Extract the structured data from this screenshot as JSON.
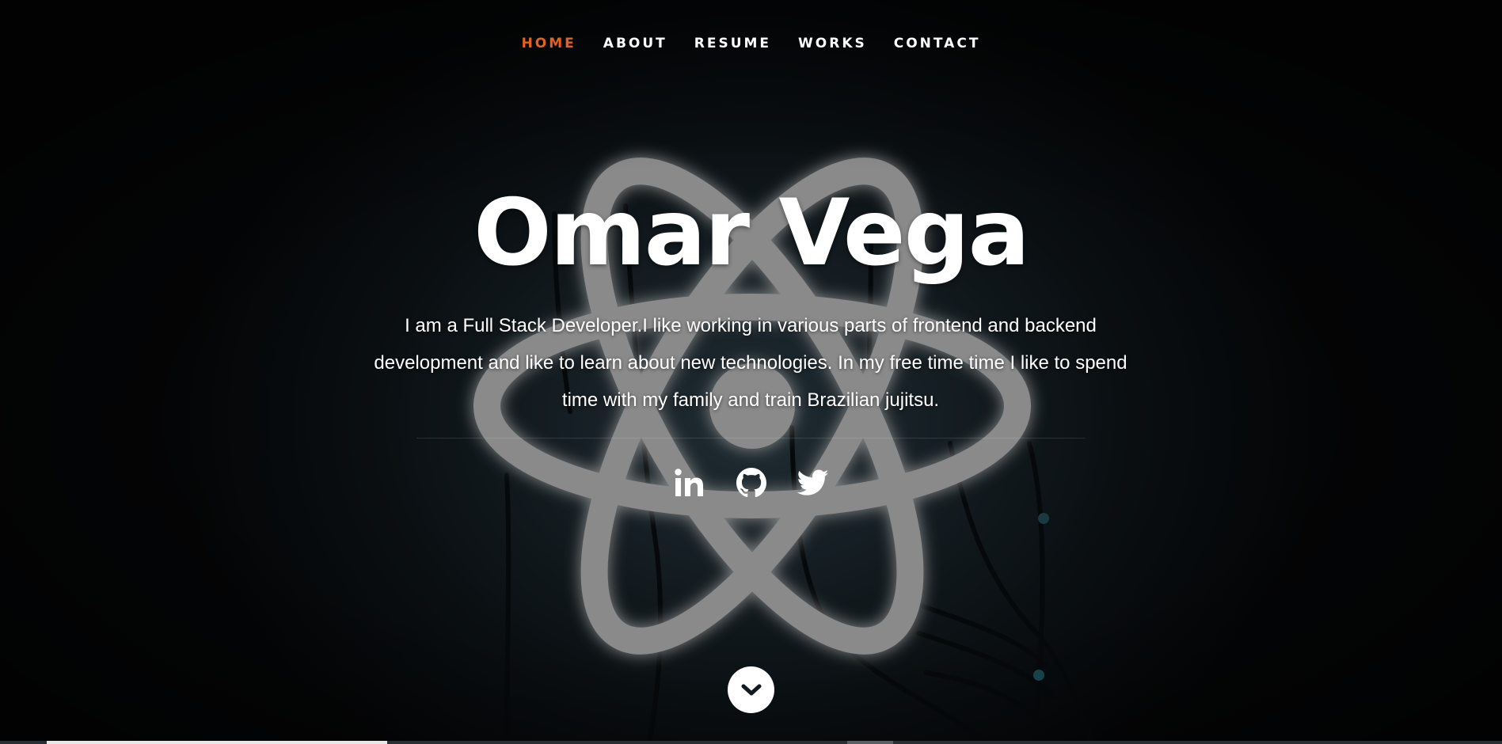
{
  "nav": {
    "items": [
      {
        "label": "HOME",
        "active": true
      },
      {
        "label": "ABOUT",
        "active": false
      },
      {
        "label": "RESUME",
        "active": false
      },
      {
        "label": "WORKS",
        "active": false
      },
      {
        "label": "CONTACT",
        "active": false
      }
    ],
    "active_color": "#e6621a"
  },
  "hero": {
    "name": "Omar Vega",
    "bio": "I am a Full Stack Developer.I like working in various parts of frontend and backend development and like to learn about new technologies. In my free time time I like to spend time with my family and train Brazilian jujitsu."
  },
  "social": [
    {
      "icon": "linkedin-icon"
    },
    {
      "icon": "github-icon"
    },
    {
      "icon": "twitter-icon"
    }
  ],
  "scroll": {
    "icon": "chevron-down-icon"
  }
}
